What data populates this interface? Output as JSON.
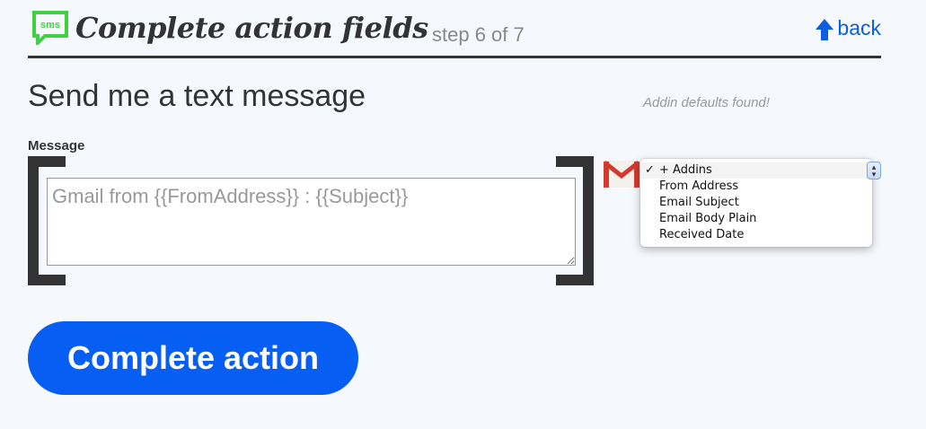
{
  "header": {
    "icon_text": "sms",
    "title": "Complete action fields",
    "step": "step 6 of 7",
    "back_label": "back"
  },
  "action": {
    "title": "Send me a text message",
    "defaults_note": "Addin defaults found!"
  },
  "message_field": {
    "label": "Message",
    "placeholder": "Gmail from {{FromAddress}} : {{Subject}}",
    "value": ""
  },
  "addins_dropdown": {
    "selected_mark": "✓",
    "options": [
      {
        "label": "+ Addins",
        "selected": true
      },
      {
        "label": "From Address",
        "selected": false
      },
      {
        "label": "Email Subject",
        "selected": false
      },
      {
        "label": "Email Body Plain",
        "selected": false
      },
      {
        "label": "Received Date",
        "selected": false
      }
    ]
  },
  "primary_button": {
    "label": "Complete action"
  },
  "icons": {
    "sms": "sms-bubble-icon",
    "back": "arrow-up-icon",
    "gmail": "gmail-icon"
  },
  "colors": {
    "accent": "#075ef2",
    "sms_green": "#3fd13f",
    "link": "#0a5ee0",
    "text": "#333333"
  }
}
